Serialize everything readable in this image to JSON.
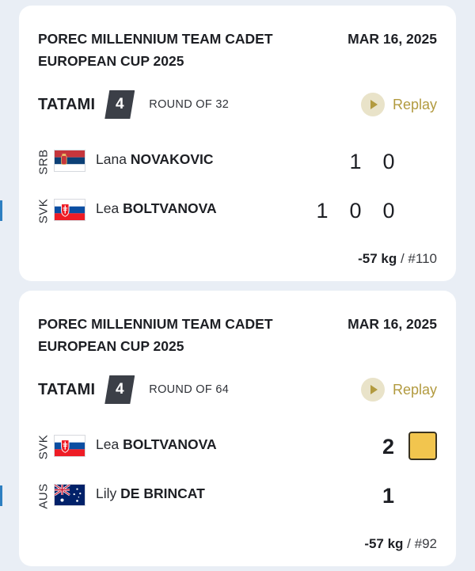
{
  "cards": [
    {
      "event": "POREC MILLENNIUM TEAM CADET EUROPEAN CUP 2025",
      "date": "MAR 16, 2025",
      "tatami_label": "TATAMI",
      "tatami_number": "4",
      "round": "ROUND OF 32",
      "replay_label": "Replay",
      "athletes": [
        {
          "country": "SRB",
          "first": "Lana",
          "last": "NOVAKOVIC",
          "scores": [
            "1",
            "0"
          ],
          "winner": false
        },
        {
          "country": "SVK",
          "first": "Lea",
          "last": "BOLTVANOVA",
          "scores": [
            "1",
            "0",
            "0"
          ],
          "winner": true
        }
      ],
      "weight": "-57 kg",
      "match": " / #110"
    },
    {
      "event": "POREC MILLENNIUM TEAM CADET EUROPEAN CUP 2025",
      "date": "MAR 16, 2025",
      "tatami_label": "TATAMI",
      "tatami_number": "4",
      "round": "ROUND OF 64",
      "replay_label": "Replay",
      "athletes": [
        {
          "country": "SVK",
          "first": "Lea",
          "last": "BOLTVANOVA",
          "scores": [
            "2"
          ],
          "winner": false,
          "penalty": "shido-yellow-card"
        },
        {
          "country": "AUS",
          "first": "Lily",
          "last": "DE BRINCAT",
          "scores": [
            "1"
          ],
          "winner": true
        }
      ],
      "weight": "-57 kg",
      "match": " / #92"
    }
  ],
  "colors": {
    "accent_gold": "#b29a3f",
    "winner_bar": "#2e7fc1",
    "shido_yellow": "#f2c54e",
    "tatami_badge": "#3b3f47"
  },
  "icons": {
    "replay": "play-circle-icon"
  }
}
